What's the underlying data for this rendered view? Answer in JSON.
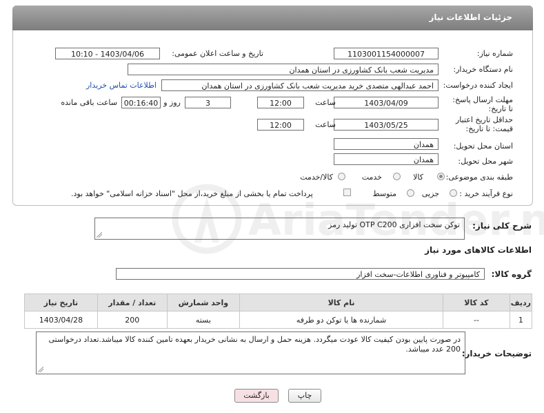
{
  "header": {
    "title": "جزئیات اطلاعات نیاز"
  },
  "fields": {
    "need_number_label": "شماره نیاز:",
    "need_number_value": "1103001154000007",
    "announce_label": "تاریخ و ساعت اعلان عمومی:",
    "announce_value": "1403/04/06 - 10:10",
    "buyer_org_label": "نام دستگاه خریدار:",
    "buyer_org_value": "مدیریت شعب بانک کشاورزی در استان همدان",
    "creator_label": "ایجاد کننده درخواست:",
    "creator_value": "احمد  عبدالهی متصدی خرید مدیریت شعب بانک کشاورزی در استان همدان",
    "contact_link": "اطلاعات تماس خریدار",
    "reply_deadline_label": "مهلت ارسال پاسخ: تا تاریخ:",
    "reply_date": "1403/04/09",
    "time_label": "ساعت",
    "reply_time": "12:00",
    "days_value": "3",
    "days_label": "روز و",
    "remaining_value": "00:16:40",
    "remaining_label": "ساعت باقی مانده",
    "price_valid_label": "حداقل تاریخ اعتبار قیمت: تا تاریخ:",
    "price_date": "1403/05/25",
    "price_time": "12:00",
    "province_label": "استان محل تحویل:",
    "province_value": "همدان",
    "city_label": "شهر محل تحویل:",
    "city_value": "همدان",
    "category_label": "طبقه بندی موضوعی:",
    "category_options": [
      "کالا",
      "خدمت",
      "کالا/خدمت"
    ],
    "category_selected": "کالا",
    "process_label": "نوع فرآیند خرید :",
    "process_options": [
      "جزیی",
      "متوسط"
    ],
    "process_note": "پرداخت تمام یا بخشی از مبلغ خرید،از محل \"اسناد خزانه اسلامی\" خواهد بود."
  },
  "description": {
    "label": "شرح کلی نیاز:",
    "value": "توکن سخت افزاری OTP C200 تولید رمز"
  },
  "goods_info_title": "اطلاعات کالاهای مورد نیاز",
  "goods_group": {
    "label": "گروه کالا:",
    "value": "کامپیوتر و فناوری اطلاعات-سخت افزار"
  },
  "table": {
    "headers": [
      "ردیف",
      "کد کالا",
      "نام کالا",
      "واحد شمارش",
      "تعداد / مقدار",
      "تاریخ نیاز"
    ],
    "rows": [
      [
        "1",
        "--",
        "شمارنده ها یا توکن دو طرفه",
        "بسته",
        "200",
        "1403/04/28"
      ]
    ]
  },
  "buyer_notes": {
    "label": "توضیحات خریدار:",
    "value": "در صورت پایین بودن کیفیت کالا عودت میگردد. هزینه حمل و ارسال به نشانی خریدار بعهده تامین کننده کالا میباشد.تعداد درخواستی 200 عدد میباشد."
  },
  "buttons": {
    "print": "چاپ",
    "back": "بازگشت"
  },
  "watermark": "AriaTender.neT"
}
